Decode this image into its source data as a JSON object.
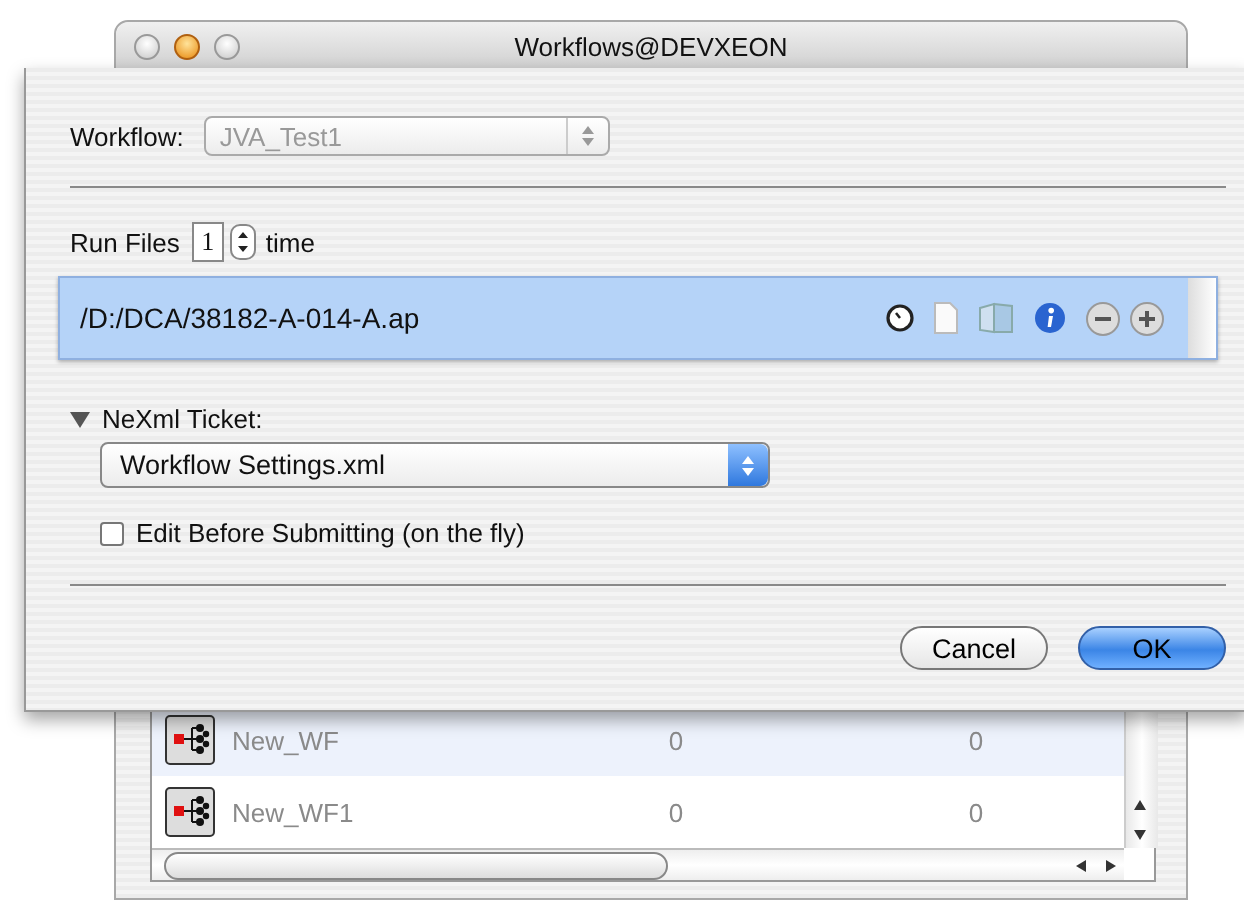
{
  "window": {
    "title": "Workflows@DEVXEON"
  },
  "workflow": {
    "label": "Workflow:",
    "value": "JVA_Test1",
    "disabled": true
  },
  "run_files": {
    "label": "Run Files",
    "count": "1",
    "suffix": "time"
  },
  "files": [
    {
      "path": "/D:/DCA/38182-A-014-A.ap",
      "selected": true
    }
  ],
  "ticket": {
    "label": "NeXml Ticket:",
    "expanded": true,
    "value": "Workflow Settings.xml"
  },
  "edit_option": {
    "label": "Edit Before Submitting (on the fly)",
    "checked": false
  },
  "buttons": [
    {
      "label": "Cancel",
      "kind": "cancel"
    },
    {
      "label": "OK",
      "kind": "default"
    }
  ],
  "background_table": {
    "rows": [
      {
        "name": "New_WF",
        "column_2": "0",
        "column_3": "0"
      },
      {
        "name": "New_WF1",
        "column_2": "0",
        "column_3": "0"
      }
    ]
  }
}
